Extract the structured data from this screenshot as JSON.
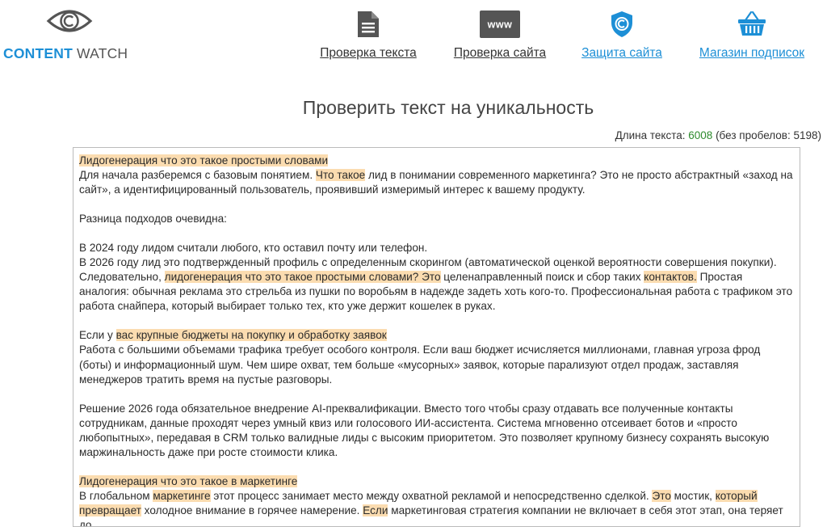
{
  "brand": {
    "name_part1": "CONTENT",
    "name_part2": "WATCH"
  },
  "nav": {
    "check_text": "Проверка текста",
    "check_site": "Проверка сайта",
    "protect_site": "Защита сайта",
    "shop": "Магазин подписок"
  },
  "colors": {
    "accent": "#1d8fd6",
    "highlight": "#fbdcb0",
    "green": "#2e8b2e"
  },
  "page": {
    "title": "Проверить текст на уникальность",
    "length_label": "Длина текста: ",
    "length_value": "6008",
    "length_rest": " (без пробелов: 5198)"
  },
  "text": {
    "p1_h": "Лидогенерация что это такое простыми словами",
    "p2_a": "Для начала разберемся с базовым понятием. ",
    "p2_h": "Что такое",
    "p2_b": " лид в понимании современного маркетинга? Это не просто абстрактный «заход на сайт», а идентифицированный пользователь, проявивший измеримый интерес к вашему продукту.",
    "p3": "Разница подходов очевидна:",
    "p4": "В 2024 году лидом считали любого, кто оставил почту или телефон.",
    "p5_a": "В 2026 году лид это подтвержденный профиль с определенным скорингом (автоматической оценкой вероятности совершения покупки). Следовательно, ",
    "p5_h1": "лидогенерация что это такое простыми словами? Это",
    "p5_b": " целенаправленный поиск и сбор таких ",
    "p5_h2": "контактов.",
    "p5_c": " Простая аналогия: обычная реклама это стрельба из пушки по воробьям в надежде задеть хоть кого-то. Профессиональная работа с трафиком это работа снайпера, который выбирает только тех, кто уже держит кошелек в руках.",
    "p6_a": "Если у ",
    "p6_h": "вас крупные бюджеты на покупку и обработку заявок",
    "p7": "Работа с большими объемами трафика требует особого контроля. Если ваш бюджет исчисляется миллионами, главная угроза фрод (боты) и информационный шум. Чем шире охват, тем больше «мусорных» заявок, которые парализуют отдел продаж, заставляя менеджеров тратить время на пустые разговоры.",
    "p8": "Решение 2026 года обязательное внедрение AI-преквалификации. Вместо того чтобы сразу отдавать все полученные контакты сотрудникам, данные проходят через умный квиз или голосового ИИ-ассистента. Система мгновенно отсеивает ботов и «просто любопытных», передавая в CRM только валидные лиды с высоким приоритетом. Это позволяет крупному бизнесу сохранять высокую маржинальность даже при росте стоимости клика.",
    "p9_h": "Лидогенерация что это такое в маркетинге",
    "p10_a": "В глобальном ",
    "p10_h1": "маркетинге",
    "p10_b": " этот процесс занимает место между охватной рекламой и непосредственно сделкой. ",
    "p10_h2": "Это",
    "p10_c": " мостик, ",
    "p10_h3": "который превращает",
    "p10_d": " холодное внимание в горячее намерение. ",
    "p10_h4": "Если",
    "p10_e": " маркетинговая стратегия компании не включает в себя этот этап, она теряет до"
  }
}
